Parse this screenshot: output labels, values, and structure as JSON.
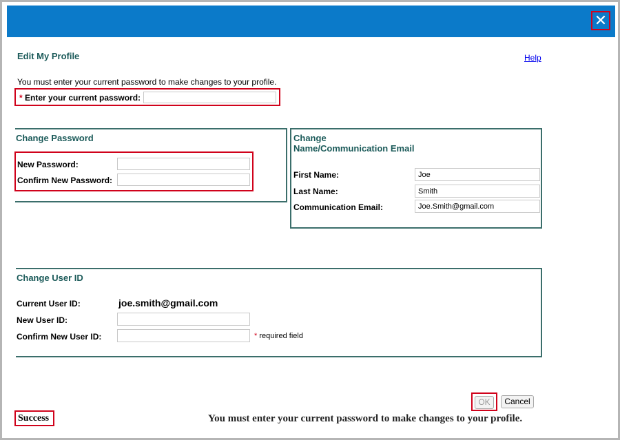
{
  "window": {
    "close_glyph": "✕",
    "close_icon": "close-icon"
  },
  "header": {
    "title": "Edit My Profile",
    "help_link": "Help"
  },
  "current_password": {
    "instruction": "You must enter your current password to make changes to your profile.",
    "required_marker": "*",
    "label": "Enter your current password:",
    "value": ""
  },
  "change_password": {
    "title": "Change Password",
    "new_label": "New Password:",
    "new_value": "",
    "confirm_label": "Confirm New Password:",
    "confirm_value": ""
  },
  "change_name": {
    "title_line1": "Change",
    "title_line2": "Name/Communication Email",
    "first_name_label": "First Name:",
    "first_name_value": "Joe",
    "last_name_label": "Last Name:",
    "last_name_value": "Smith",
    "email_label": "Communication Email:",
    "email_value": "Joe.Smith@gmail.com"
  },
  "change_user_id": {
    "title": "Change User ID",
    "current_label": "Current User ID:",
    "current_value": "joe.smith@gmail.com",
    "new_label": "New User ID:",
    "new_value": "",
    "confirm_label": "Confirm New User ID:",
    "confirm_value": "",
    "required_marker": "*",
    "required_note": "required field"
  },
  "actions": {
    "ok_label": "OK",
    "cancel_label": "Cancel"
  },
  "status": {
    "result": "Success",
    "message": "You must enter your current password to make changes to your profile."
  },
  "colors": {
    "title_bar": "#0b7ac9",
    "highlight": "#d0021b",
    "section_heading": "#1b5a59",
    "panel_border": "#3b6e6b"
  }
}
